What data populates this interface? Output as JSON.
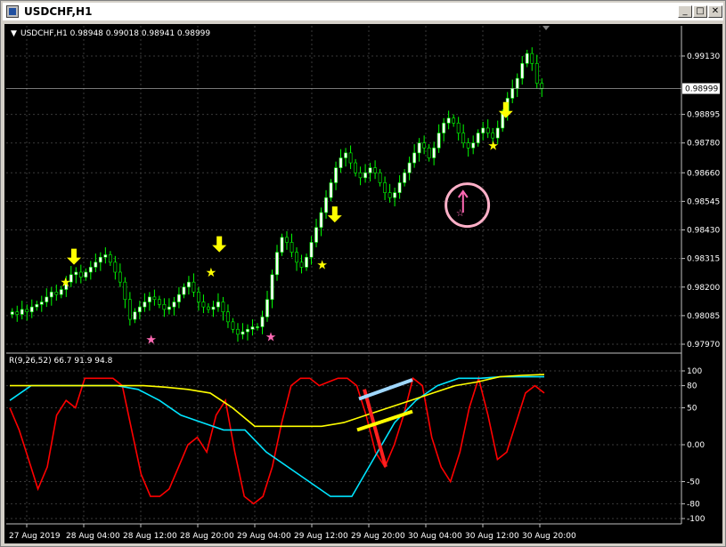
{
  "window": {
    "title": "USDCHF,H1",
    "minimize": "_",
    "maximize": "□",
    "close": "✕"
  },
  "chart_data": [
    {
      "type": "candlestick",
      "label": "USDCHF,H1  0.98948 0.99018 0.98941 0.98999",
      "ylim": [
        0.9797,
        0.9918
      ],
      "y_ticks": [
        "0.99130",
        "0.98895",
        "0.98780",
        "0.98660",
        "0.98545",
        "0.98430",
        "0.98315",
        "0.98200",
        "0.98085",
        "0.97970"
      ],
      "current_price": "0.98999",
      "up_color": "#ffffff",
      "down_color": "#000000",
      "wick_color": "#00ff00",
      "closes": [
        0.981,
        0.9809,
        0.9811,
        0.981,
        0.9812,
        0.9813,
        0.9814,
        0.9816,
        0.9818,
        0.9817,
        0.9819,
        0.9822,
        0.9825,
        0.9826,
        0.9824,
        0.9826,
        0.9828,
        0.983,
        0.9832,
        0.9833,
        0.983,
        0.9826,
        0.9822,
        0.9815,
        0.9807,
        0.981,
        0.9812,
        0.9814,
        0.9816,
        0.9815,
        0.9813,
        0.9811,
        0.9812,
        0.9814,
        0.9817,
        0.982,
        0.9822,
        0.9818,
        0.9814,
        0.9812,
        0.9811,
        0.9812,
        0.9814,
        0.981,
        0.9806,
        0.9803,
        0.9801,
        0.9802,
        0.9803,
        0.9804,
        0.9804,
        0.9808,
        0.9815,
        0.9825,
        0.9834,
        0.984,
        0.9838,
        0.9834,
        0.983,
        0.9828,
        0.9832,
        0.9838,
        0.9844,
        0.985,
        0.9856,
        0.9862,
        0.9868,
        0.9872,
        0.9874,
        0.987,
        0.9866,
        0.9864,
        0.9866,
        0.9868,
        0.9866,
        0.9862,
        0.9858,
        0.9856,
        0.9858,
        0.9862,
        0.9866,
        0.987,
        0.9874,
        0.9878,
        0.9876,
        0.9872,
        0.9876,
        0.9882,
        0.9886,
        0.9888,
        0.9886,
        0.9882,
        0.9878,
        0.9876,
        0.9878,
        0.9882,
        0.9884,
        0.9882,
        0.988,
        0.9884,
        0.989,
        0.9896,
        0.99,
        0.9904,
        0.991,
        0.9914,
        0.991,
        0.9902,
        0.99
      ],
      "annotations": [
        {
          "kind": "arrow",
          "color": "#ffff00",
          "x_index": 15,
          "at": 0.9829
        },
        {
          "kind": "star",
          "color": "#ffff00",
          "x_index": 13,
          "at": 0.9822
        },
        {
          "kind": "arrow",
          "color": "#ffff00",
          "x_index": 49,
          "at": 0.9834
        },
        {
          "kind": "star",
          "color": "#ffff00",
          "x_index": 47,
          "at": 0.9826
        },
        {
          "kind": "arrow",
          "color": "#ffff00",
          "x_index": 76,
          "at": 0.9846
        },
        {
          "kind": "star",
          "color": "#ffff00",
          "x_index": 73,
          "at": 0.9829
        },
        {
          "kind": "arrow",
          "color": "#ffff00",
          "x_index": 116,
          "at": 0.9888
        },
        {
          "kind": "star",
          "color": "#ffff00",
          "x_index": 113,
          "at": 0.9877
        },
        {
          "kind": "star",
          "color": "#ff69b4",
          "x_index": 33,
          "at": 0.9799
        },
        {
          "kind": "star",
          "color": "#ff69b4",
          "x_index": 61,
          "at": 0.98
        },
        {
          "kind": "pink-arrow",
          "color": "#ff69b4",
          "x_index": 106,
          "at": 0.9855
        }
      ],
      "highlight": {
        "kind": "circle",
        "color": "#ffb0c8",
        "x_index": 107,
        "at": 0.9853
      }
    },
    {
      "type": "line",
      "label": "R(9,26,52) 66.7 91.9 94.8",
      "ylim": [
        -100,
        100
      ],
      "y_ticks": [
        "100",
        "80",
        "50",
        "0.00",
        "-50",
        "-80",
        "-100"
      ],
      "x_labels": [
        "27 Aug 2019",
        "28 Aug 04:00",
        "28 Aug 12:00",
        "28 Aug 20:00",
        "29 Aug 04:00",
        "29 Aug 12:00",
        "29 Aug 20:00",
        "30 Aug 04:00",
        "30 Aug 12:00",
        "30 Aug 20:00"
      ],
      "series": [
        {
          "color": "#ff0000",
          "values": [
            50,
            20,
            -20,
            -60,
            -30,
            40,
            60,
            50,
            90,
            90,
            90,
            90,
            80,
            20,
            -40,
            -70,
            -70,
            -60,
            -30,
            0,
            10,
            -10,
            40,
            60,
            -10,
            -70,
            -80,
            -70,
            -30,
            30,
            80,
            90,
            90,
            80,
            85,
            90,
            90,
            80,
            40,
            -10,
            -30,
            0,
            40,
            90,
            80,
            10,
            -30,
            -50,
            -10,
            50,
            90,
            40,
            -20,
            -10,
            30,
            70,
            80,
            70
          ]
        },
        {
          "color": "#00e5ff",
          "values": [
            60,
            80,
            80,
            80,
            80,
            80,
            75,
            60,
            40,
            30,
            20,
            20,
            -10,
            -30,
            -50,
            -70,
            -70,
            -20,
            30,
            60,
            80,
            90,
            90,
            92,
            92,
            92
          ]
        },
        {
          "color": "#ffff00",
          "values": [
            80,
            80,
            80,
            80,
            80,
            80,
            80,
            78,
            75,
            70,
            50,
            25,
            25,
            25,
            25,
            30,
            40,
            50,
            60,
            70,
            80,
            85,
            92,
            94,
            95
          ]
        }
      ],
      "drawings": [
        {
          "color": "#ff2020",
          "label": "red-trendline"
        },
        {
          "color": "#a0d8ff",
          "label": "lightblue-trendline"
        },
        {
          "color": "#ffff00",
          "label": "yellow-trendline"
        }
      ]
    }
  ]
}
